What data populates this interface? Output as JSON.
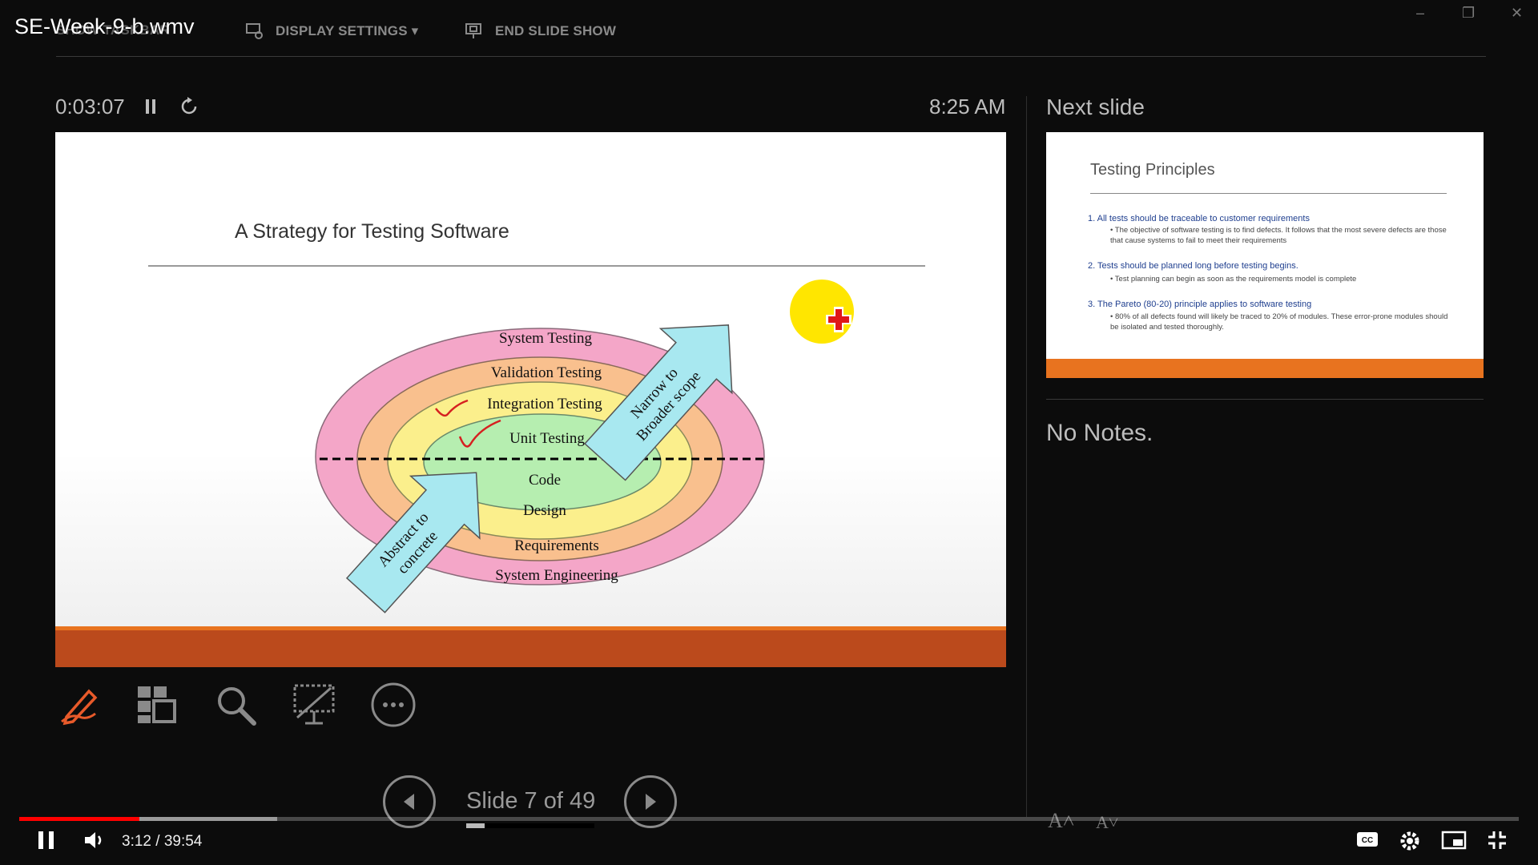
{
  "video": {
    "title": "SE-Week-9-b.wmv",
    "current_time": "3:12",
    "duration": "39:54",
    "time_display": "3:12 / 39:54",
    "played_fraction": 0.08
  },
  "toolbar": {
    "taskbar_label": "SHOW TASKBAR",
    "display_settings_label": "DISPLAY SETTINGS ▾",
    "end_show_label": "END SLIDE SHOW"
  },
  "presenter": {
    "elapsed": "0:03:07",
    "clock": "8:25 AM",
    "next_slide_label": "Next slide",
    "notes": "No Notes.",
    "slide_counter": "Slide 7 of 49",
    "slide_progress_fraction": 0.143
  },
  "current_slide": {
    "title": "A Strategy for Testing Software",
    "rings": [
      "System Testing",
      "Validation Testing",
      "Integration Testing",
      "Unit Testing",
      "Code",
      "Design",
      "Requirements",
      "System Engineering"
    ],
    "arrow_up": [
      "Narrow to",
      "Broader scope"
    ],
    "arrow_down": [
      "Abstract to",
      "concrete"
    ]
  },
  "next_slide": {
    "title": "Testing Principles",
    "points": [
      {
        "heading": "1. All tests should be traceable to customer requirements",
        "bullet": "The objective of software testing is to find defects. It follows that the most severe defects are those that cause systems to fail to meet their requirements"
      },
      {
        "heading": "2. Tests should be planned long before testing begins.",
        "bullet": "Test planning can begin as soon as the requirements model is complete"
      },
      {
        "heading": "3. The Pareto (80-20) principle applies to software testing",
        "bullet": "80% of all defects found will likely be traced to 20% of modules. These error-prone modules should be isolated and tested thoroughly."
      }
    ]
  },
  "colors": {
    "accent_orange": "#e8731f",
    "footer_dark": "#bb4a1c",
    "yt_red": "#ff0000",
    "pointer_yellow": "#ffe600"
  },
  "icons": [
    "pen-tool-icon",
    "see-all-slides-icon",
    "zoom-icon",
    "black-screen-icon",
    "more-options-icon",
    "prev-slide-icon",
    "next-slide-icon",
    "pause-icon",
    "reset-icon",
    "volume-icon",
    "captions-icon",
    "settings-icon",
    "miniplayer-icon",
    "exit-fullscreen-icon"
  ]
}
